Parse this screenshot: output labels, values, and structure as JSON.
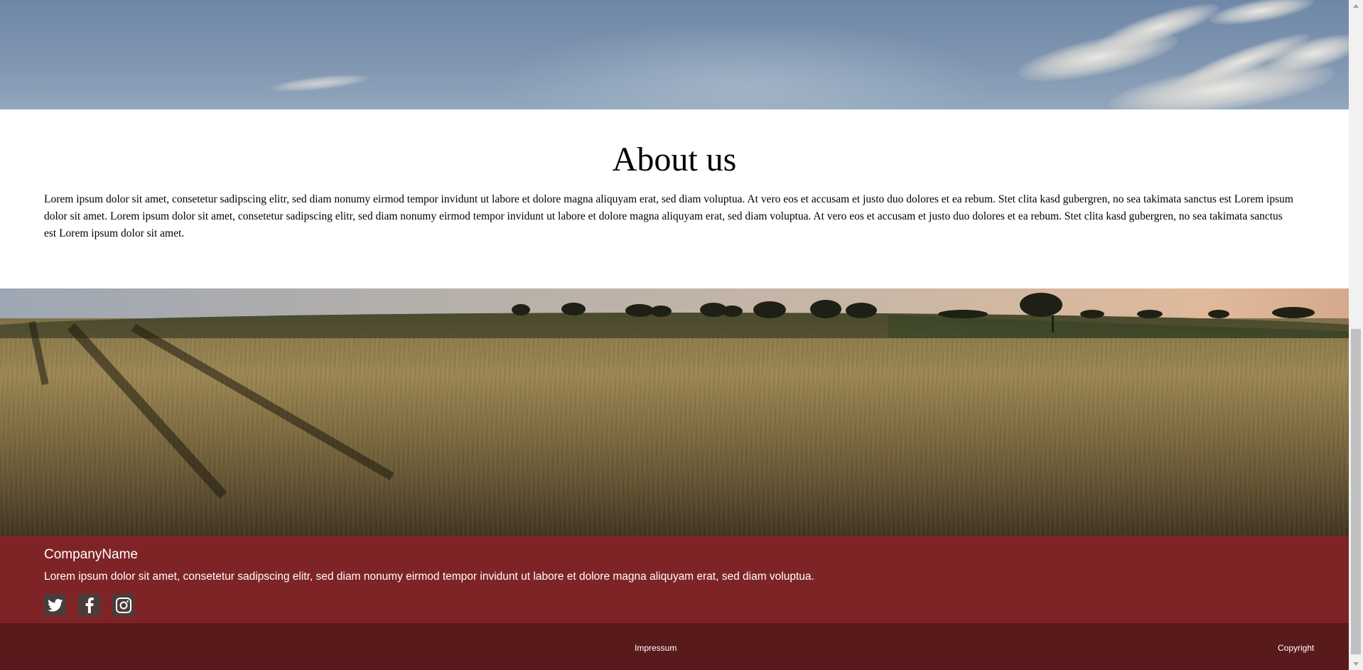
{
  "about": {
    "title": "About us",
    "text": "Lorem ipsum dolor sit amet, consetetur sadipscing elitr, sed diam nonumy eirmod tempor invidunt ut labore et dolore magna aliquyam erat, sed diam voluptua. At vero eos et accusam et justo duo dolores et ea rebum. Stet clita kasd gubergren, no sea takimata sanctus est Lorem ipsum dolor sit amet. Lorem ipsum dolor sit amet, consetetur sadipscing elitr, sed diam nonumy eirmod tempor invidunt ut labore et dolore magna aliquyam erat, sed diam voluptua. At vero eos et accusam et justo duo dolores et ea rebum. Stet clita kasd gubergren, no sea takimata sanctus est Lorem ipsum dolor sit amet."
  },
  "footer": {
    "company_name": "CompanyName",
    "description": "Lorem ipsum dolor sit amet, consetetur sadipscing elitr, sed diam nonumy eirmod tempor invidunt ut labore et dolore magna aliquyam erat, sed diam voluptua.",
    "social": [
      {
        "icon": "twitter-icon"
      },
      {
        "icon": "facebook-icon"
      },
      {
        "icon": "instagram-icon"
      }
    ],
    "links": {
      "impressum": "Impressum",
      "copyright": "Copyright"
    }
  },
  "colors": {
    "footer_main": "#7f2426",
    "footer_bottom": "#591a1c",
    "about_background": "#ffffff"
  }
}
